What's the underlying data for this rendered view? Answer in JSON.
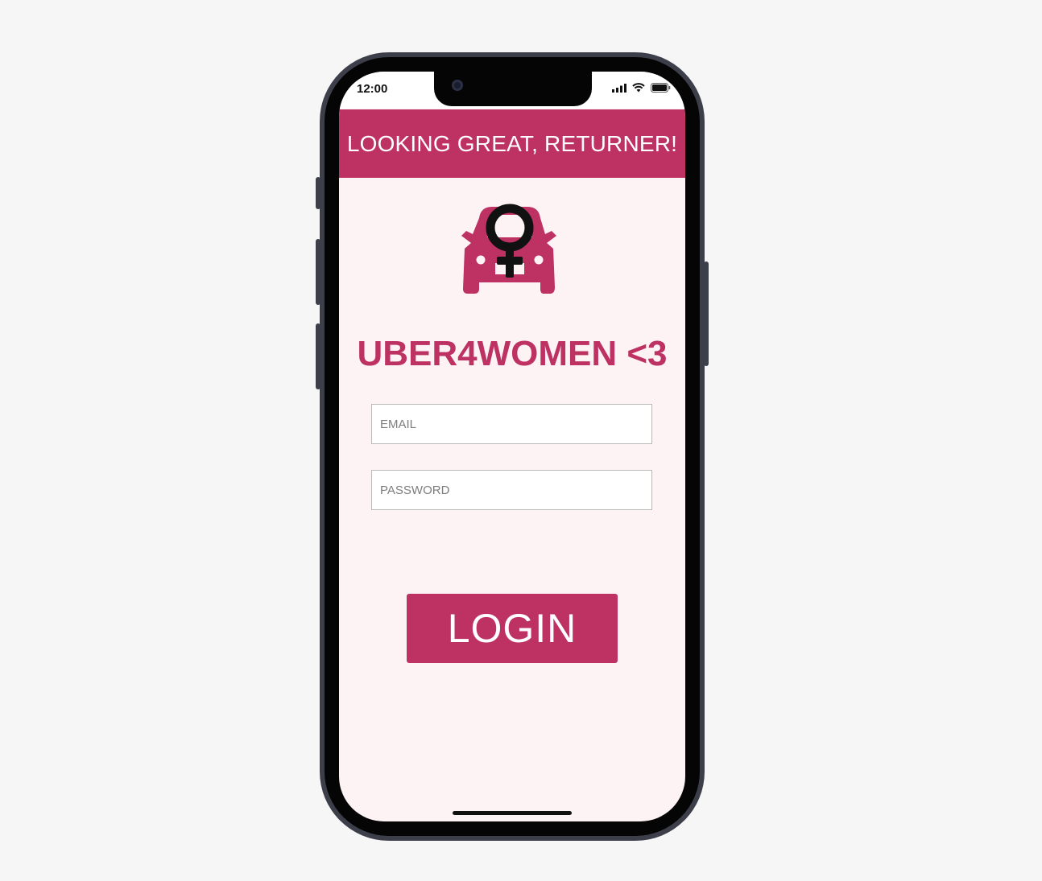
{
  "statusbar": {
    "time": "12:00",
    "icons": [
      "signal-icon",
      "wifi-icon",
      "battery-icon"
    ]
  },
  "banner": {
    "text": "LOOKING GREAT, RETURNER!"
  },
  "logo": {
    "icon": "car-female-symbol-icon"
  },
  "app": {
    "title": "UBER4WOMEN <3"
  },
  "form": {
    "email_placeholder": "EMAIL",
    "password_placeholder": "PASSWORD",
    "email_value": "",
    "password_value": ""
  },
  "actions": {
    "login_label": "LOGIN"
  },
  "colors": {
    "accent": "#bd3163",
    "screen_background": "#fdf3f4",
    "page_background": "#f6f6f6",
    "symbol": "#111111"
  }
}
